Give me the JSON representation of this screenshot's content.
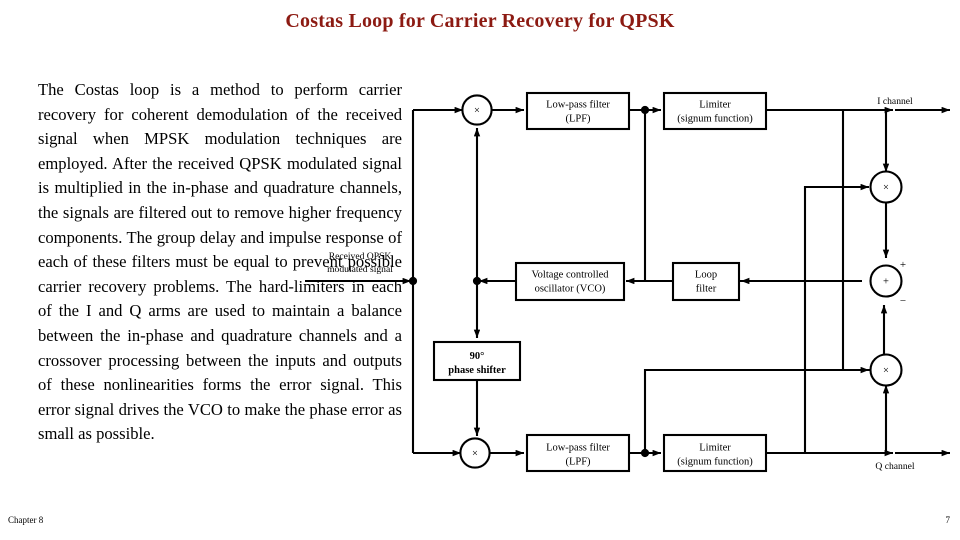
{
  "slide": {
    "title": "Costas Loop for Carrier Recovery for QPSK",
    "body": "The Costas loop is a method to perform carrier recovery for coherent demodulation of the received signal when MPSK modulation techniques are employed. After the received QPSK modulated signal is multiplied in the in-phase and quadrature channels, the signals are filtered out to remove higher frequency components. The group delay and impulse response of each of these filters must be equal to prevent possible carrier recovery problems. The hard-limiters in each of the I and Q arms are used to maintain a balance between the in-phase and quadrature channels and a crossover processing between the inputs and outputs of these nonlinearities forms the error signal. This error signal drives the VCO to make the phase error as small as possible.",
    "footer_left": "Chapter 8",
    "footer_right": "7",
    "title_color": "#8c1a12"
  },
  "diagram": {
    "blocks": {
      "lpf_top_line1": "Low-pass filter",
      "lpf_top_line2": "(LPF)",
      "limiter_top_line1": "Limiter",
      "limiter_top_line2": "(signum function)",
      "vco_line1": "Voltage controlled",
      "vco_line2": "oscillator (VCO)",
      "loop_filter_line1": "Loop",
      "loop_filter_line2": "filter",
      "phase_shifter_line1": "90°",
      "phase_shifter_line2": "phase shifter",
      "lpf_bottom_line1": "Low-pass filter",
      "lpf_bottom_line2": "(LPF)",
      "limiter_bottom_line1": "Limiter",
      "limiter_bottom_line2": "(signum function)"
    },
    "labels": {
      "input_line1": "Received QPSK",
      "input_line2": "modulated signal",
      "i_channel": "I channel",
      "q_channel": "Q channel",
      "multiplier_symbol": "×",
      "adder_symbol": "+",
      "adder_plus_sign": "+",
      "adder_minus_sign": "−"
    }
  }
}
